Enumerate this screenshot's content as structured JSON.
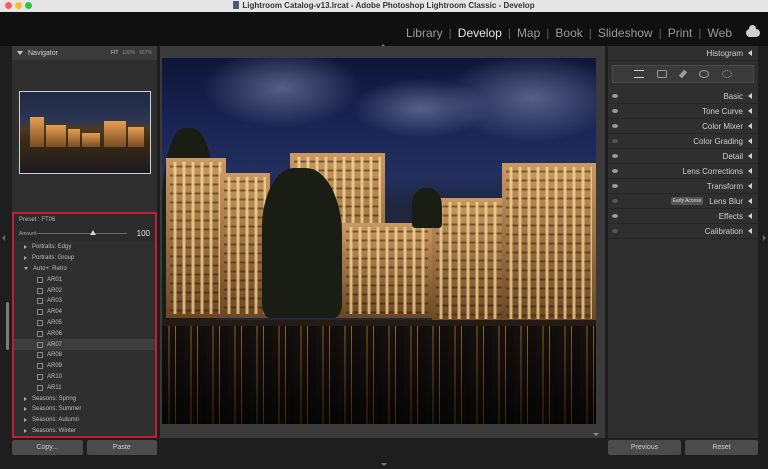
{
  "window": {
    "title": "Lightroom Catalog-v13.lrcat - Adobe Photoshop Lightroom Classic - Develop",
    "traffic_lights": [
      "#ff5f57",
      "#febc2e",
      "#28c840"
    ]
  },
  "modules": [
    "Library",
    "Develop",
    "Map",
    "Book",
    "Slideshow",
    "Print",
    "Web"
  ],
  "active_module": "Develop",
  "navigator": {
    "label": "Navigator",
    "zooms": [
      "FIT",
      "100%",
      "667%"
    ]
  },
  "preset": {
    "name_label": "Preset : FT06",
    "amount_label": "Amount",
    "amount_value": "100",
    "amount_fraction": 0.62
  },
  "presets_list": [
    {
      "label": "Portraits: Edgy",
      "kind": "group",
      "expanded": false
    },
    {
      "label": "Portraits: Group",
      "kind": "group",
      "expanded": false
    },
    {
      "label": "Auto+: Retro",
      "kind": "group",
      "expanded": true
    },
    {
      "label": "AR01",
      "kind": "item"
    },
    {
      "label": "AR02",
      "kind": "item"
    },
    {
      "label": "AR03",
      "kind": "item"
    },
    {
      "label": "AR04",
      "kind": "item"
    },
    {
      "label": "AR05",
      "kind": "item"
    },
    {
      "label": "AR06",
      "kind": "item"
    },
    {
      "label": "AR07",
      "kind": "item",
      "selected": true
    },
    {
      "label": "AR08",
      "kind": "item"
    },
    {
      "label": "AR09",
      "kind": "item"
    },
    {
      "label": "AR10",
      "kind": "item"
    },
    {
      "label": "AR11",
      "kind": "item"
    },
    {
      "label": "Seasons: Spring",
      "kind": "group",
      "expanded": false
    },
    {
      "label": "Seasons: Summer",
      "kind": "group",
      "expanded": false
    },
    {
      "label": "Seasons: Autumn",
      "kind": "group",
      "expanded": false
    },
    {
      "label": "Seasons: Winter",
      "kind": "group",
      "expanded": false
    }
  ],
  "left_buttons": {
    "copy": "Copy...",
    "paste": "Paste"
  },
  "right_panels": {
    "histogram": "Histogram",
    "sections": [
      {
        "label": "Basic",
        "eye": "on"
      },
      {
        "label": "Tone Curve",
        "eye": "on"
      },
      {
        "label": "Color Mixer",
        "eye": "on"
      },
      {
        "label": "Color Grading",
        "eye": "dim"
      },
      {
        "label": "Detail",
        "eye": "on"
      },
      {
        "label": "Lens Corrections",
        "eye": "on"
      },
      {
        "label": "Transform",
        "eye": "on"
      },
      {
        "label": "Lens Blur",
        "eye": "dim",
        "badge": "Early Access"
      },
      {
        "label": "Effects",
        "eye": "on"
      },
      {
        "label": "Calibration",
        "eye": "dim"
      }
    ]
  },
  "right_buttons": {
    "previous": "Previous",
    "reset": "Reset"
  },
  "colors": {
    "highlight_border": "#c02033",
    "accent": "#e8e8e8"
  }
}
